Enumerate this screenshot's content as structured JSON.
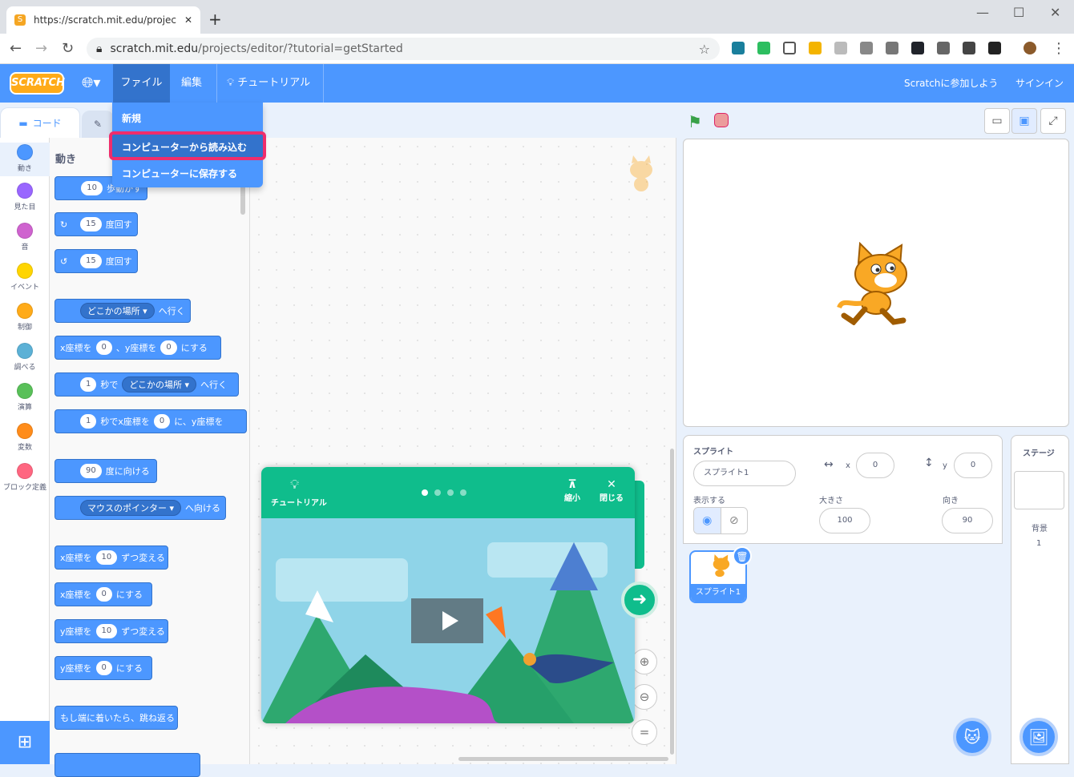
{
  "browser": {
    "tab_title": "https://scratch.mit.edu/projects/e",
    "url_host": "scratch.mit.edu",
    "url_path": "/projects/editor/?tutorial=getStarted"
  },
  "menubar": {
    "logo": "SCRATCH",
    "file": "ファイル",
    "edit": "編集",
    "tutorials": "チュートリアル",
    "join": "Scratchに参加しよう",
    "signin": "サインイン"
  },
  "file_menu": {
    "new": "新規",
    "load": "コンピューターから読み込む",
    "save": "コンピューターに保存する"
  },
  "tabs": {
    "code": "コード"
  },
  "categories": [
    {
      "label": "動き",
      "color": "#4c97ff"
    },
    {
      "label": "見た目",
      "color": "#9966ff"
    },
    {
      "label": "音",
      "color": "#cf63cf"
    },
    {
      "label": "イベント",
      "color": "#ffd500"
    },
    {
      "label": "制御",
      "color": "#ffab19"
    },
    {
      "label": "調べる",
      "color": "#5cb1d6"
    },
    {
      "label": "演算",
      "color": "#59c059"
    },
    {
      "label": "変数",
      "color": "#ff8c1a"
    },
    {
      "label": "ブロック定義",
      "color": "#ff6680"
    }
  ],
  "palette": {
    "heading": "動き",
    "b1": {
      "n": "10",
      "t": "歩動かす"
    },
    "b2": {
      "n": "15",
      "t": "度回す"
    },
    "b3": {
      "n": "15",
      "t": "度回す"
    },
    "b4": {
      "d": "どこかの場所 ▾",
      "t": "へ行く"
    },
    "b5": {
      "a": "x座標を",
      "n1": "0",
      "b": "、y座標を",
      "n2": "0",
      "c": "にする"
    },
    "b6": {
      "n": "1",
      "a": "秒で",
      "d": "どこかの場所 ▾",
      "t": "へ行く"
    },
    "b7": {
      "n": "1",
      "a": "秒でx座標を",
      "n2": "0",
      "b": "に、y座標を"
    },
    "b8": {
      "n": "90",
      "t": "度に向ける"
    },
    "b9": {
      "d": "マウスのポインター ▾",
      "t": "へ向ける"
    },
    "b10": {
      "a": "x座標を",
      "n": "10",
      "t": "ずつ変える"
    },
    "b11": {
      "a": "x座標を",
      "n": "0",
      "t": "にする"
    },
    "b12": {
      "a": "y座標を",
      "n": "10",
      "t": "ずつ変える"
    },
    "b13": {
      "a": "y座標を",
      "n": "0",
      "t": "にする"
    },
    "b14": {
      "t": "もし端に着いたら、跳ね返る"
    }
  },
  "tutorial": {
    "title": "チュートリアル",
    "shrink": "縮小",
    "close": "閉じる",
    "step_count": 4,
    "current_step": 1
  },
  "sprite_info": {
    "sprite_label": "スプライト",
    "name": "スプライト1",
    "x_label": "x",
    "x": "0",
    "y_label": "y",
    "y": "0",
    "show_label": "表示する",
    "size_label": "大きさ",
    "size": "100",
    "dir_label": "向き",
    "direction": "90"
  },
  "sprites": [
    {
      "name": "スプライト1"
    }
  ],
  "stage_panel": {
    "title": "ステージ",
    "backdrop_label": "背景",
    "backdrop_count": "1"
  }
}
